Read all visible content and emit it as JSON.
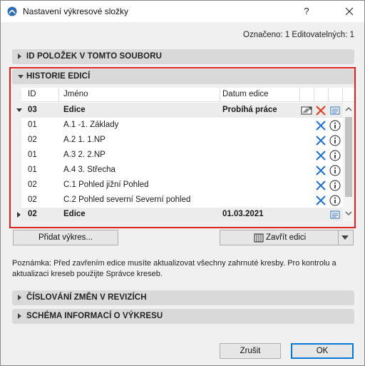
{
  "window": {
    "title": "Nastavení výkresové složky",
    "help_label": "?"
  },
  "selection_status": "Označeno: 1 Editovatelných: 1",
  "sections": {
    "ids": "ID POLOŽEK V TOMTO SOUBORU",
    "history": "HISTORIE EDICÍ",
    "revisions": "ČÍSLOVÁNÍ ZMĚN V REVIZÍCH",
    "schema": "SCHÉMA INFORMACÍ O VÝKRESU"
  },
  "table": {
    "headers": {
      "id": "ID",
      "name": "Jméno",
      "date": "Datum edice"
    },
    "rows": [
      {
        "kind": "edition",
        "id": "03",
        "name": "Edice",
        "date": "Probíhá práce",
        "expanded": true,
        "icons": [
          "edit-edition-icon",
          "delete-icon",
          "info-list-icon"
        ]
      },
      {
        "kind": "drawing",
        "id": "01",
        "name": "A.1 -1. Základy",
        "date": "",
        "icons": [
          "delete-icon",
          "info-icon"
        ]
      },
      {
        "kind": "drawing",
        "id": "02",
        "name": "A.2 1. 1.NP",
        "date": "",
        "icons": [
          "delete-icon",
          "info-icon"
        ]
      },
      {
        "kind": "drawing",
        "id": "01",
        "name": "A.3 2. 2.NP",
        "date": "",
        "icons": [
          "delete-icon",
          "info-icon"
        ]
      },
      {
        "kind": "drawing",
        "id": "01",
        "name": "A.4 3. Střecha",
        "date": "",
        "icons": [
          "delete-icon",
          "info-icon"
        ]
      },
      {
        "kind": "drawing",
        "id": "02",
        "name": "C.1 Pohled jižní Pohled",
        "date": "",
        "icons": [
          "delete-icon",
          "info-icon"
        ]
      },
      {
        "kind": "drawing",
        "id": "02",
        "name": "C.2 Pohled severní Severní pohled",
        "date": "",
        "icons": [
          "delete-icon",
          "info-icon"
        ]
      },
      {
        "kind": "edition",
        "id": "02",
        "name": "Edice",
        "date": "01.03.2021",
        "expanded": false,
        "icons": [
          "info-list-icon"
        ]
      }
    ]
  },
  "buttons": {
    "add_drawing": "Přidat výkres...",
    "close_edition": "Zavřít edici",
    "cancel": "Zrušit",
    "ok": "OK"
  },
  "note": "Poznámka: Před zavřením edice musíte aktualizovat všechny zahrnuté kresby. Pro kontrolu a aktualizaci kreseb použijte Správce kreseb.",
  "colors": {
    "highlight_frame": "#e32020",
    "delete_icon": "#1f6fd1",
    "ok_border": "#0078d7"
  }
}
